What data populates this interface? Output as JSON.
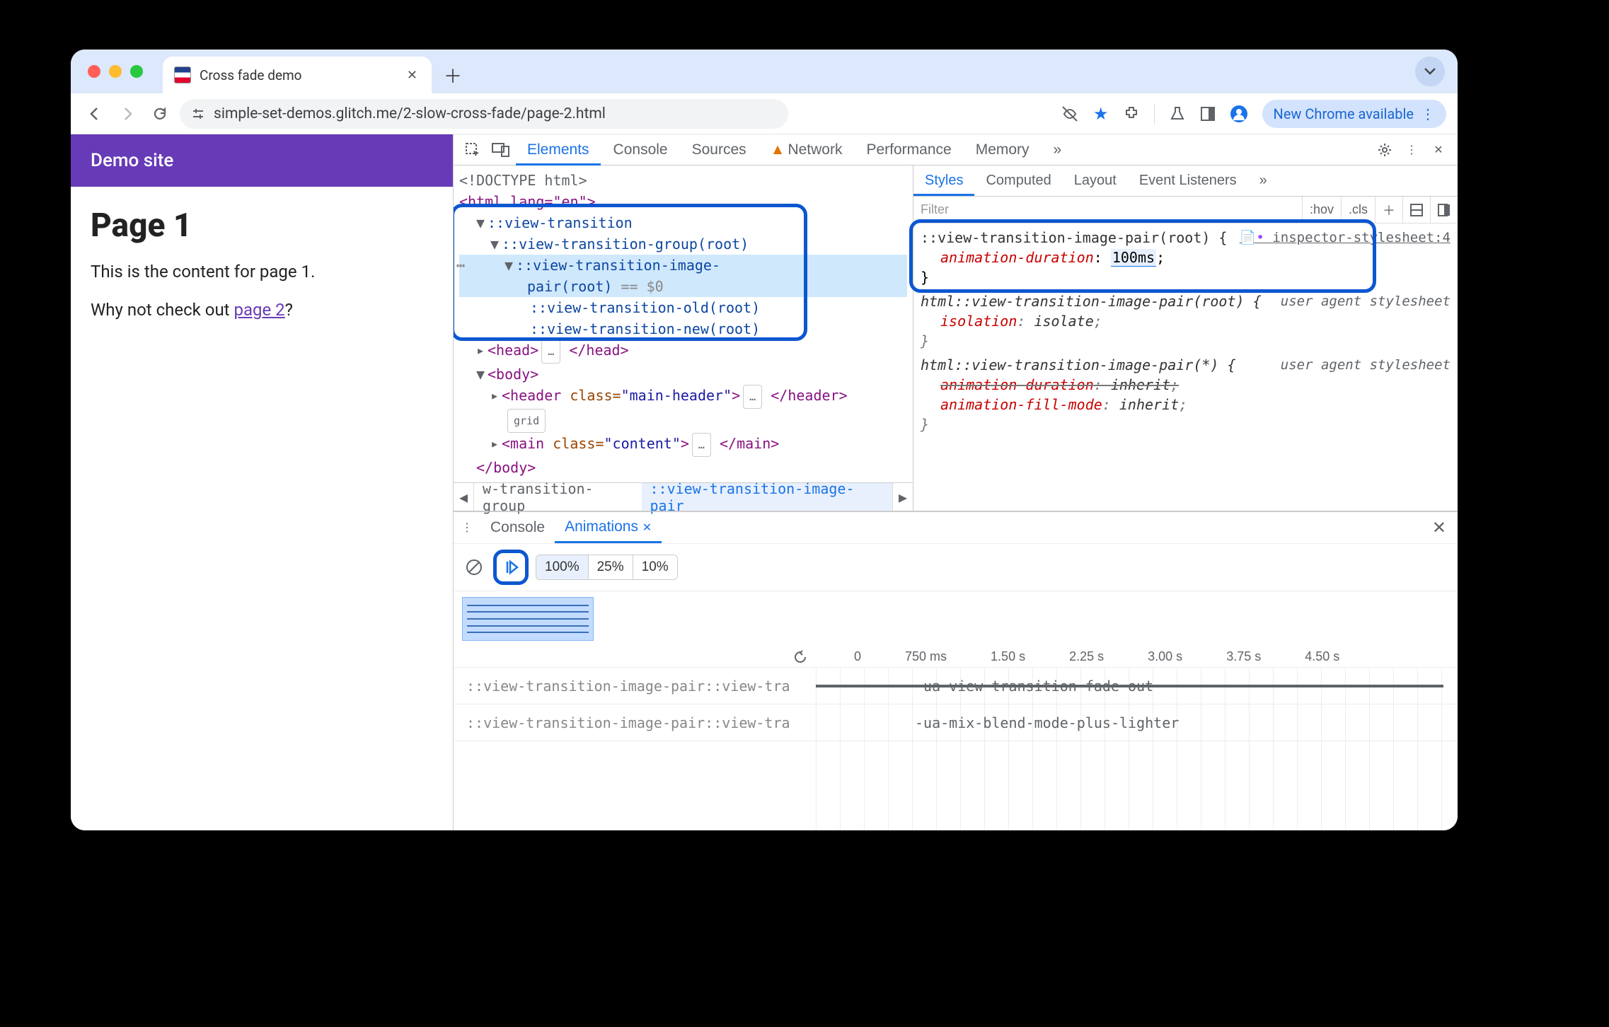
{
  "tab": {
    "title": "Cross fade demo"
  },
  "url": "simple-set-demos.glitch.me/2-slow-cross-fade/page-2.html",
  "update_pill": "New Chrome available",
  "page": {
    "header": "Demo site",
    "h1": "Page 1",
    "p1": "This is the content for page 1.",
    "p2_pre": "Why not check out ",
    "p2_link": "page 2",
    "p2_post": "?"
  },
  "devtools_tabs": [
    "Elements",
    "Console",
    "Sources",
    "Network",
    "Performance",
    "Memory"
  ],
  "dom": {
    "doctype": "<!DOCTYPE html>",
    "html_open": "<html lang=\"en\">",
    "vt": "::view-transition",
    "vt_group": "::view-transition-group(root)",
    "vt_pair_a": "::view-transition-image-",
    "vt_pair_b": "pair(root)",
    "vt_pair_eq": "== $0",
    "vt_old": "::view-transition-old(root)",
    "vt_new": "::view-transition-new(root)",
    "head": "<head>…</head>",
    "body_open": "<body>",
    "header_line": "<header class=\"main-header\">…</header>",
    "grid_badge": "grid",
    "main_line": "<main class=\"content\">…</main>",
    "body_close": "</body>",
    "bc1": "w-transition-group",
    "bc2": "::view-transition-image-pair"
  },
  "styles_tabs": [
    "Styles",
    "Computed",
    "Layout",
    "Event Listeners"
  ],
  "styles": {
    "filter_placeholder": "Filter",
    "hov": ":hov",
    "cls": ".cls",
    "rule1_selector": "::view-transition-image-pair(root) {",
    "rule1_link": "inspector-stylesheet:4",
    "rule1_prop": "animation-duration",
    "rule1_val": "100ms",
    "rule2_selector": "html::view-transition-image-pair(root) {",
    "rule2_link": "user agent stylesheet",
    "rule2_prop": "isolation",
    "rule2_val": "isolate",
    "rule3_selector": "html::view-transition-image-pair(*) {",
    "rule3_link": "user agent stylesheet",
    "rule3_p1": "animation-duration",
    "rule3_v1": "inherit",
    "rule3_p2": "animation-fill-mode",
    "rule3_v2": "inherit"
  },
  "drawer": {
    "tabs": [
      "Console",
      "Animations"
    ],
    "speeds": [
      "100%",
      "25%",
      "10%"
    ],
    "ticks": [
      "0",
      "750 ms",
      "1.50 s",
      "2.25 s",
      "3.00 s",
      "3.75 s",
      "4.50 s"
    ],
    "row1_label": "::view-transition-image-pair::view-tra",
    "row1_track": "-ua-view-transition-fade-out",
    "row2_label": "::view-transition-image-pair::view-tra",
    "row2_track": "-ua-mix-blend-mode-plus-lighter"
  }
}
